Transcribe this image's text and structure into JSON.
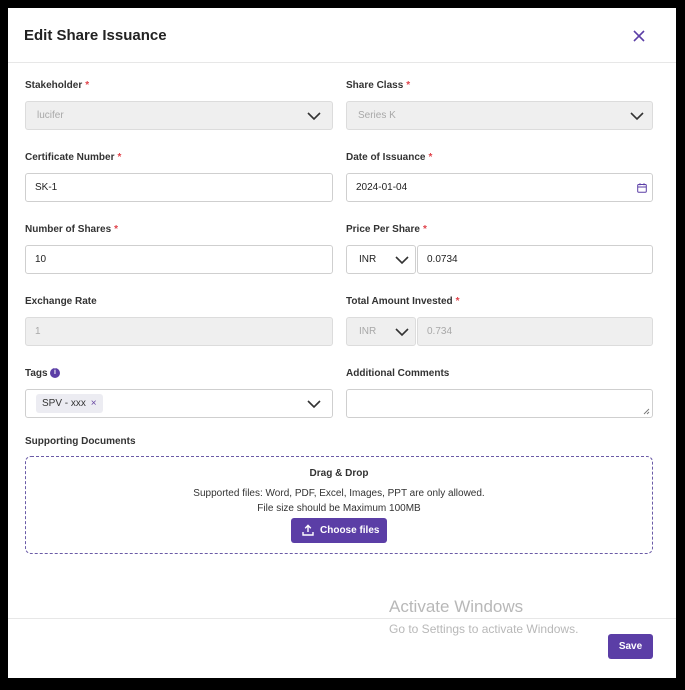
{
  "dialog": {
    "title": "Edit Share Issuance",
    "close_icon": "close-icon"
  },
  "required_mark": "*",
  "fields": {
    "stakeholder": {
      "label": "Stakeholder",
      "value": "lucifer",
      "required": true,
      "disabled": true
    },
    "share_class": {
      "label": "Share Class",
      "value": "Series K",
      "required": true,
      "disabled": true
    },
    "certificate_number": {
      "label": "Certificate Number",
      "value": "SK-1",
      "required": true
    },
    "date_of_issuance": {
      "label": "Date of Issuance",
      "value": "2024-01-04",
      "required": true,
      "icon": "calendar-icon"
    },
    "number_of_shares": {
      "label": "Number of Shares",
      "value": "10",
      "required": true
    },
    "price_per_share": {
      "label": "Price Per Share",
      "currency": "INR",
      "value": "0.0734",
      "required": true
    },
    "exchange_rate": {
      "label": "Exchange Rate",
      "value": "1",
      "disabled": true
    },
    "total_amount_invested": {
      "label": "Total Amount Invested",
      "currency": "INR",
      "value": "0.734",
      "required": true,
      "disabled": true
    },
    "tags": {
      "label": "Tags",
      "info_icon": "info-icon",
      "chips": [
        "SPV - xxx"
      ],
      "chip_remove": "×"
    },
    "additional_comments": {
      "label": "Additional Comments",
      "value": ""
    }
  },
  "supporting_documents": {
    "label": "Supporting Documents",
    "dropzone_title": "Drag & Drop",
    "supported_text": "Supported files: Word, PDF, Excel, Images, PPT are only allowed.",
    "size_text": "File size should be Maximum 100MB",
    "choose_button": "Choose files",
    "upload_icon": "upload-icon"
  },
  "footer": {
    "save_button": "Save"
  },
  "watermark": {
    "line1": "Activate Windows",
    "line2": "Go to Settings to activate Windows."
  },
  "colors": {
    "accent": "#5b3ea6",
    "required": "#e0434b",
    "disabled_bg": "#efefef"
  }
}
